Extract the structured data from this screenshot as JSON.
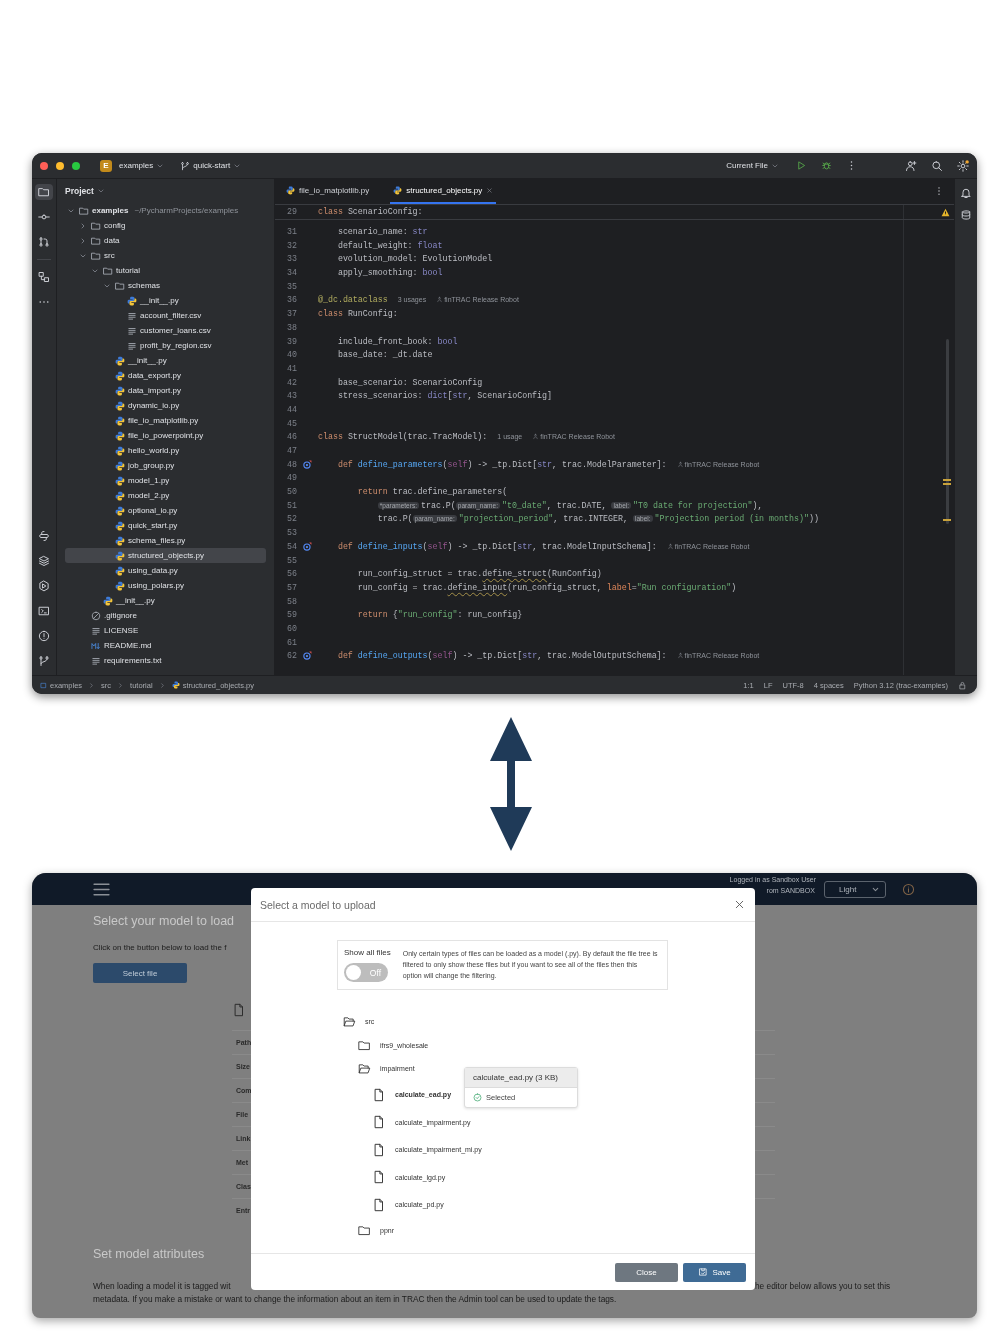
{
  "ide": {
    "title_bar": {
      "project_badge": "E",
      "project": "examples",
      "branch": "quick-start",
      "run_config": "Current File"
    },
    "tool_strip": {
      "top": [
        {
          "kind": "project",
          "selected": true
        },
        {
          "kind": "commit",
          "selected": false
        },
        {
          "kind": "pull_requests",
          "selected": false
        },
        {
          "kind": "structure",
          "selected": false
        },
        {
          "kind": "more",
          "selected": false
        }
      ],
      "bottom": [
        {
          "kind": "python_console",
          "selected": false
        },
        {
          "kind": "layers",
          "selected": false
        },
        {
          "kind": "services",
          "selected": false
        },
        {
          "kind": "terminal",
          "selected": false
        },
        {
          "kind": "problems",
          "selected": false
        },
        {
          "kind": "git",
          "selected": false
        }
      ]
    },
    "project_panel": {
      "title": "Project",
      "tree": [
        {
          "label": "examples",
          "kind": "folder",
          "hint": "~/PycharmProjects/examples",
          "expanded": true,
          "selected": false,
          "children": [
            {
              "label": "config",
              "kind": "folder",
              "expanded": false,
              "selected": false
            },
            {
              "label": "data",
              "kind": "folder",
              "expanded": false,
              "selected": false
            },
            {
              "label": "src",
              "kind": "folder",
              "expanded": true,
              "selected": false,
              "children": [
                {
                  "label": "tutorial",
                  "kind": "folder",
                  "expanded": true,
                  "selected": false,
                  "children": [
                    {
                      "label": "schemas",
                      "kind": "folder",
                      "expanded": true,
                      "selected": false,
                      "children": [
                        {
                          "label": "__init__.py",
                          "kind": "python",
                          "selected": false
                        },
                        {
                          "label": "account_filter.csv",
                          "kind": "csv",
                          "selected": false
                        },
                        {
                          "label": "customer_loans.csv",
                          "kind": "csv",
                          "selected": false
                        },
                        {
                          "label": "profit_by_region.csv",
                          "kind": "csv",
                          "selected": false
                        }
                      ]
                    },
                    {
                      "label": "__init__.py",
                      "kind": "python",
                      "selected": false
                    },
                    {
                      "label": "data_export.py",
                      "kind": "python",
                      "selected": false
                    },
                    {
                      "label": "data_import.py",
                      "kind": "python",
                      "selected": false
                    },
                    {
                      "label": "dynamic_io.py",
                      "kind": "python",
                      "selected": false
                    },
                    {
                      "label": "file_io_matplotlib.py",
                      "kind": "python",
                      "selected": false
                    },
                    {
                      "label": "file_io_powerpoint.py",
                      "kind": "python",
                      "selected": false
                    },
                    {
                      "label": "hello_world.py",
                      "kind": "python",
                      "selected": false
                    },
                    {
                      "label": "job_group.py",
                      "kind": "python",
                      "selected": false
                    },
                    {
                      "label": "model_1.py",
                      "kind": "python",
                      "selected": false
                    },
                    {
                      "label": "model_2.py",
                      "kind": "python",
                      "selected": false
                    },
                    {
                      "label": "optional_io.py",
                      "kind": "python",
                      "selected": false
                    },
                    {
                      "label": "quick_start.py",
                      "kind": "python",
                      "selected": false
                    },
                    {
                      "label": "schema_files.py",
                      "kind": "python",
                      "selected": false
                    },
                    {
                      "label": "structured_objects.py",
                      "kind": "python",
                      "selected": true
                    },
                    {
                      "label": "using_data.py",
                      "kind": "python",
                      "selected": false
                    },
                    {
                      "label": "using_polars.py",
                      "kind": "python",
                      "selected": false
                    }
                  ]
                },
                {
                  "label": "__init__.py",
                  "kind": "python",
                  "selected": false
                }
              ]
            },
            {
              "label": ".gitignore",
              "kind": "gitignore",
              "selected": false
            },
            {
              "label": "LICENSE",
              "kind": "text",
              "selected": false
            },
            {
              "label": "README.md",
              "kind": "markdown",
              "selected": false
            },
            {
              "label": "requirements.txt",
              "kind": "text",
              "selected": false
            }
          ]
        }
      ]
    },
    "tabs": [
      {
        "label": "file_io_matplotlib.py",
        "selected": false
      },
      {
        "label": "structured_objects.py",
        "selected": true
      }
    ],
    "sticky_line": {
      "number": "29",
      "override_mark": false,
      "segments": [
        {
          "kind": "kw",
          "text": "class "
        },
        {
          "kind": "plain",
          "text": "ScenarioConfig:"
        }
      ]
    },
    "code_lines": [
      {
        "number": "31",
        "override_mark": false,
        "segments": [
          {
            "kind": "plain",
            "text": "    scenario_name: "
          },
          {
            "kind": "builtin",
            "text": "str"
          }
        ]
      },
      {
        "number": "32",
        "override_mark": false,
        "segments": [
          {
            "kind": "plain",
            "text": "    default_weight: "
          },
          {
            "kind": "builtin",
            "text": "float"
          }
        ]
      },
      {
        "number": "33",
        "override_mark": false,
        "segments": [
          {
            "kind": "plain",
            "text": "    evolution_model: EvolutionModel"
          }
        ]
      },
      {
        "number": "34",
        "override_mark": false,
        "segments": [
          {
            "kind": "plain",
            "text": "    apply_smoothing: "
          },
          {
            "kind": "builtin",
            "text": "bool"
          }
        ]
      },
      {
        "number": "35",
        "override_mark": false
      },
      {
        "number": "36",
        "override_mark": false,
        "segments": [
          {
            "kind": "deco",
            "text": "@_dc.dataclass"
          },
          {
            "kind": "hint",
            "text": "3 usages"
          },
          {
            "kind": "author",
            "text": "finTRAC Release Robot"
          }
        ]
      },
      {
        "number": "37",
        "override_mark": false,
        "segments": [
          {
            "kind": "kw",
            "text": "class "
          },
          {
            "kind": "plain",
            "text": "RunConfig:"
          }
        ]
      },
      {
        "number": "38",
        "override_mark": false
      },
      {
        "number": "39",
        "override_mark": false,
        "segments": [
          {
            "kind": "plain",
            "text": "    include_front_book: "
          },
          {
            "kind": "builtin",
            "text": "bool"
          }
        ]
      },
      {
        "number": "40",
        "override_mark": false,
        "segments": [
          {
            "kind": "plain",
            "text": "    base_date: _dt.date"
          }
        ]
      },
      {
        "number": "41",
        "override_mark": false
      },
      {
        "number": "42",
        "override_mark": false,
        "segments": [
          {
            "kind": "plain",
            "text": "    base_scenario: ScenarioConfig"
          }
        ]
      },
      {
        "number": "43",
        "override_mark": false,
        "segments": [
          {
            "kind": "plain",
            "text": "    stress_scenarios: "
          },
          {
            "kind": "builtin",
            "text": "dict"
          },
          {
            "kind": "plain",
            "text": "["
          },
          {
            "kind": "builtin",
            "text": "str"
          },
          {
            "kind": "plain",
            "text": ", ScenarioConfig]"
          }
        ]
      },
      {
        "number": "44",
        "override_mark": false
      },
      {
        "number": "45",
        "override_mark": false
      },
      {
        "number": "46",
        "override_mark": false,
        "segments": [
          {
            "kind": "kw",
            "text": "class "
          },
          {
            "kind": "plain",
            "text": "StructModel(trac.TracModel):"
          },
          {
            "kind": "hint",
            "text": "1 usage"
          },
          {
            "kind": "author",
            "text": "finTRAC Release Robot"
          }
        ]
      },
      {
        "number": "47",
        "override_mark": false
      },
      {
        "number": "48",
        "override_mark": true,
        "segments": [
          {
            "kind": "kw",
            "text": "    def "
          },
          {
            "kind": "fn",
            "text": "define_parameters"
          },
          {
            "kind": "plain",
            "text": "("
          },
          {
            "kind": "self",
            "text": "self"
          },
          {
            "kind": "plain",
            "text": ") -> _tp.Dict["
          },
          {
            "kind": "builtin",
            "text": "str"
          },
          {
            "kind": "plain",
            "text": ", trac.ModelParameter]:"
          },
          {
            "kind": "author",
            "text": "finTRAC Release Robot"
          }
        ]
      },
      {
        "number": "49",
        "override_mark": false
      },
      {
        "number": "50",
        "override_mark": false,
        "segments": [
          {
            "kind": "kw",
            "text": "        return "
          },
          {
            "kind": "plain",
            "text": "trac.define_parameters("
          }
        ]
      },
      {
        "number": "51",
        "override_mark": false,
        "segments": [
          {
            "kind": "plain",
            "text": "            trac.P(",
            "inlay": "*parameters:"
          },
          {
            "kind": "str",
            "text": "\"t0_date\"",
            "inlay": "param_name:"
          },
          {
            "kind": "plain",
            "text": ", trac.DATE, "
          },
          {
            "kind": "str",
            "text": "\"T0 date for projection\"",
            "inlay": "label:"
          },
          {
            "kind": "plain",
            "text": "),"
          }
        ]
      },
      {
        "number": "52",
        "override_mark": false,
        "segments": [
          {
            "kind": "plain",
            "text": "            trac.P("
          },
          {
            "kind": "str",
            "text": "\"projection_period\"",
            "inlay": "param_name:"
          },
          {
            "kind": "plain",
            "text": ", trac.INTEGER, "
          },
          {
            "kind": "str",
            "text": "\"Projection period (in months)\"",
            "inlay": "label:"
          },
          {
            "kind": "plain",
            "text": "))"
          }
        ]
      },
      {
        "number": "53",
        "override_mark": false
      },
      {
        "number": "54",
        "override_mark": true,
        "segments": [
          {
            "kind": "kw",
            "text": "    def "
          },
          {
            "kind": "fn",
            "text": "define_inputs"
          },
          {
            "kind": "plain",
            "text": "("
          },
          {
            "kind": "self",
            "text": "self"
          },
          {
            "kind": "plain",
            "text": ") -> _tp.Dict["
          },
          {
            "kind": "builtin",
            "text": "str"
          },
          {
            "kind": "plain",
            "text": ", trac.ModelInputSchema]:"
          },
          {
            "kind": "author",
            "text": "finTRAC Release Robot"
          }
        ]
      },
      {
        "number": "55",
        "override_mark": false
      },
      {
        "number": "56",
        "override_mark": false,
        "segments": [
          {
            "kind": "plain",
            "text": "        run_config_struct = trac."
          },
          {
            "kind": "warn",
            "text": "define_struct"
          },
          {
            "kind": "plain",
            "text": "(RunConfig)"
          }
        ]
      },
      {
        "number": "57",
        "override_mark": false,
        "segments": [
          {
            "kind": "plain",
            "text": "        run_config = trac."
          },
          {
            "kind": "warn",
            "text": "define_input"
          },
          {
            "kind": "plain",
            "text": "(run_config_struct, "
          },
          {
            "kind": "param",
            "text": "label"
          },
          {
            "kind": "plain",
            "text": "="
          },
          {
            "kind": "str",
            "text": "\"Run configuration\""
          },
          {
            "kind": "plain",
            "text": ")"
          }
        ]
      },
      {
        "number": "58",
        "override_mark": false
      },
      {
        "number": "59",
        "override_mark": false,
        "segments": [
          {
            "kind": "kw",
            "text": "        return "
          },
          {
            "kind": "plain",
            "text": "{"
          },
          {
            "kind": "str",
            "text": "\"run_config\""
          },
          {
            "kind": "plain",
            "text": ": run_config}"
          }
        ]
      },
      {
        "number": "60",
        "override_mark": false
      },
      {
        "number": "61",
        "override_mark": false
      },
      {
        "number": "62",
        "override_mark": true,
        "segments": [
          {
            "kind": "kw",
            "text": "    def "
          },
          {
            "kind": "fn",
            "text": "define_outputs"
          },
          {
            "kind": "plain",
            "text": "("
          },
          {
            "kind": "self",
            "text": "self"
          },
          {
            "kind": "plain",
            "text": ") -> _tp.Dict["
          },
          {
            "kind": "builtin",
            "text": "str"
          },
          {
            "kind": "plain",
            "text": ", trac.ModelOutputSchema]:"
          },
          {
            "kind": "author",
            "text": "finTRAC Release Robot"
          }
        ]
      }
    ],
    "status_bar": {
      "breadcrumbs": [
        "examples",
        "src",
        "tutorial",
        "structured_objects.py"
      ],
      "items": [
        "1:1",
        "LF",
        "UTF-8",
        "4 spaces",
        "Python 3.12 (trac-examples)"
      ]
    }
  },
  "web_app": {
    "header": {
      "user_line_1": "Logged in as Sandbox User",
      "user_line_2": "rom SANDBOX",
      "theme": "Light"
    },
    "page": {
      "heading": "Select your model to load",
      "intro": "Click on the button below to load the f",
      "select_button": "Select file",
      "table_labels": [
        "Path",
        "Size",
        "Com",
        "File",
        "Link",
        "Met",
        "Clas",
        "Entr"
      ],
      "attributes_heading": "Set model attributes",
      "paragraph_left": "When loading a model it is tagged wit",
      "paragraph_right": "he editor below allows you to set this",
      "paragraph_line_2": "metadata. If you make a mistake or want to change the information about an item in TRAC then the Admin tool can be used to update the tags."
    },
    "dialog": {
      "title": "Select a model to upload",
      "show_all": {
        "label": "Show all files",
        "on": false,
        "state_label": "Off",
        "description": "Only certain types of files can be loaded as a model (.py). By default the file tree is filtered to only show these files but if you want to see all of the files then this option will change the filtering."
      },
      "tree": [
        {
          "label": "src",
          "kind": "folder",
          "expanded": true,
          "selected": false,
          "children": [
            {
              "label": "ifrs9_wholesale",
              "kind": "folder",
              "expanded": false,
              "selected": false
            },
            {
              "label": "impairment",
              "kind": "folder",
              "expanded": true,
              "selected": false,
              "children": [
                {
                  "label": "calculate_ead.py",
                  "kind": "file",
                  "selected": true
                },
                {
                  "label": "calculate_impairment.py",
                  "kind": "file",
                  "selected": false
                },
                {
                  "label": "calculate_impairment_mi.py",
                  "kind": "file",
                  "selected": false
                },
                {
                  "label": "calculate_lgd.py",
                  "kind": "file",
                  "selected": false
                },
                {
                  "label": "calculate_pd.py",
                  "kind": "file",
                  "selected": false
                }
              ]
            },
            {
              "label": "ppnr",
              "kind": "folder",
              "expanded": false,
              "selected": false
            }
          ]
        }
      ],
      "popover": {
        "title": "calculate_ead.py (3 KB)",
        "status": "Selected"
      },
      "buttons": [
        {
          "label": "Close",
          "kind": "secondary"
        },
        {
          "label": "Save",
          "kind": "primary"
        }
      ]
    }
  }
}
